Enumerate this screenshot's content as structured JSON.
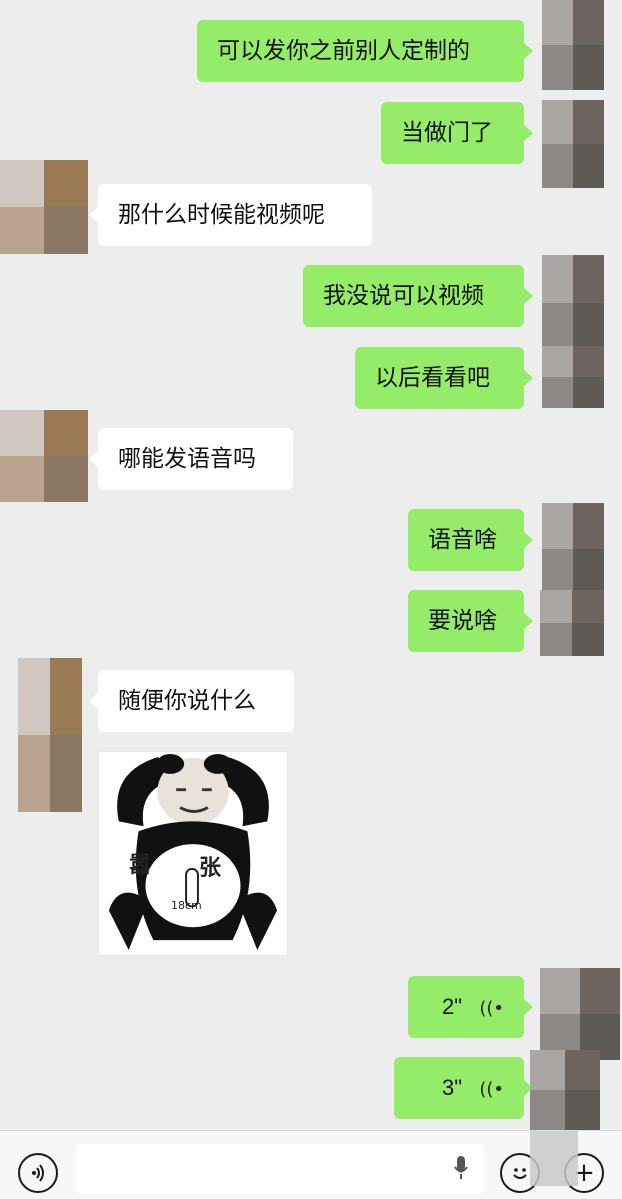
{
  "messages": [
    {
      "side": "out",
      "text": "可以发你之前别人定制的"
    },
    {
      "side": "out",
      "text": "当做门了"
    },
    {
      "side": "in",
      "text": "那什么时候能视频呢"
    },
    {
      "side": "out",
      "text": "我没说可以视频"
    },
    {
      "side": "out",
      "text": "以后看看吧"
    },
    {
      "side": "in",
      "text": "哪能发语音吗"
    },
    {
      "side": "out",
      "text": "语音啥"
    },
    {
      "side": "out",
      "text": "要说啥"
    },
    {
      "side": "in",
      "text": "随便你说什么"
    }
  ],
  "sticker": {
    "text_left": "嚣",
    "text_right": "张",
    "text_small": "18cm"
  },
  "voice_messages": [
    {
      "duration": "2\"",
      "icon": "voice-wave-icon"
    },
    {
      "duration": "3\"",
      "icon": "voice-wave-icon"
    }
  ],
  "input_bar": {
    "voice_toggle_icon": "voice-toggle-icon",
    "mic_icon": "microphone-icon",
    "emoji_icon": "emoji-icon",
    "plus_icon": "plus-icon"
  },
  "colors": {
    "outgoing_bubble": "#95ec69",
    "incoming_bubble": "#ffffff",
    "background": "#ededed"
  }
}
